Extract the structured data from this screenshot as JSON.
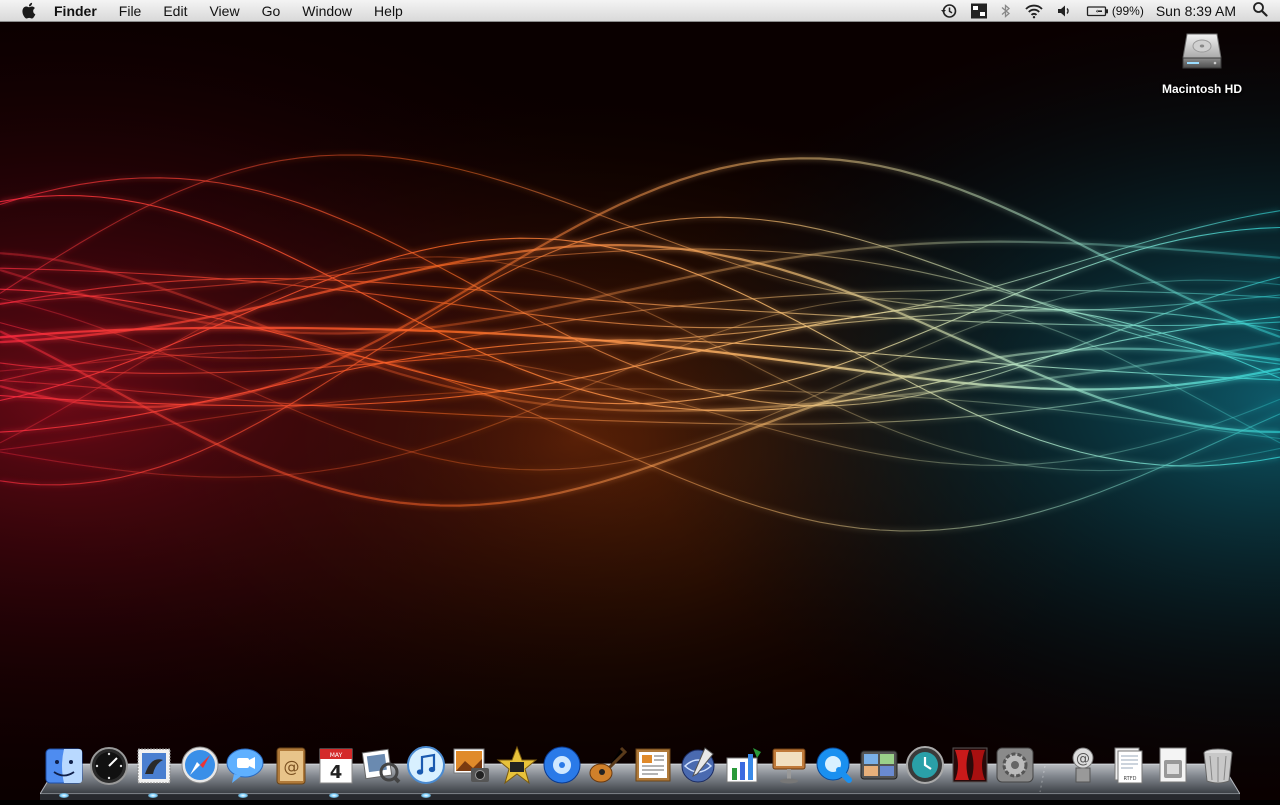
{
  "menubar": {
    "app_name": "Finder",
    "menus": [
      "File",
      "Edit",
      "View",
      "Go",
      "Window",
      "Help"
    ],
    "battery_percent": "(99%)",
    "clock": "Sun 8:39 AM",
    "status_icons": [
      "time-machine-icon",
      "sidebar-app-icon",
      "bluetooth-icon",
      "wifi-icon",
      "volume-icon",
      "battery-icon",
      "spotlight-icon"
    ]
  },
  "desktop": {
    "items": [
      {
        "label": "Macintosh HD",
        "icon": "hard-drive-icon"
      }
    ]
  },
  "dock": {
    "apps": [
      {
        "name": "Finder",
        "icon": "finder-icon",
        "running": true
      },
      {
        "name": "Dashboard",
        "icon": "dashboard-icon",
        "running": false
      },
      {
        "name": "Mail",
        "icon": "mail-icon",
        "running": true
      },
      {
        "name": "Safari",
        "icon": "safari-icon",
        "running": false
      },
      {
        "name": "iChat",
        "icon": "ichat-icon",
        "running": true
      },
      {
        "name": "Address Book",
        "icon": "address-book-icon",
        "running": false
      },
      {
        "name": "iCal",
        "icon": "ical-icon",
        "running": true
      },
      {
        "name": "Preview",
        "icon": "preview-icon",
        "running": false
      },
      {
        "name": "iTunes",
        "icon": "itunes-icon",
        "running": true
      },
      {
        "name": "iPhoto",
        "icon": "iphoto-icon",
        "running": false
      },
      {
        "name": "iMovie",
        "icon": "imovie-icon",
        "running": false
      },
      {
        "name": "iDVD",
        "icon": "idvd-icon",
        "running": false
      },
      {
        "name": "GarageBand",
        "icon": "garageband-icon",
        "running": false
      },
      {
        "name": "Pages",
        "icon": "pages-icon",
        "running": false
      },
      {
        "name": "iWeb",
        "icon": "iweb-icon",
        "running": false
      },
      {
        "name": "Numbers",
        "icon": "numbers-icon",
        "running": false
      },
      {
        "name": "Keynote",
        "icon": "keynote-icon",
        "running": false
      },
      {
        "name": "QuickTime Player",
        "icon": "quicktime-icon",
        "running": false
      },
      {
        "name": "Spaces",
        "icon": "spaces-icon",
        "running": false
      },
      {
        "name": "Time Machine",
        "icon": "time-machine-icon",
        "running": false
      },
      {
        "name": "Front Row",
        "icon": "front-row-icon",
        "running": false
      },
      {
        "name": "System Preferences",
        "icon": "system-preferences-icon",
        "running": false
      }
    ],
    "stacks": [
      {
        "name": "Sites",
        "icon": "sites-stack-icon"
      },
      {
        "name": "Documents",
        "icon": "documents-stack-icon"
      },
      {
        "name": "Downloads",
        "icon": "downloads-stack-icon"
      },
      {
        "name": "Trash",
        "icon": "trash-icon"
      }
    ],
    "ical_date": "4",
    "ical_month": "MAY",
    "documents_tag": "RTFD"
  },
  "colors": {
    "wave_red": "#ff3344",
    "wave_orange": "#ff7a2a",
    "wave_yellow": "#ffd27a",
    "wave_teal": "#37d6d0"
  }
}
